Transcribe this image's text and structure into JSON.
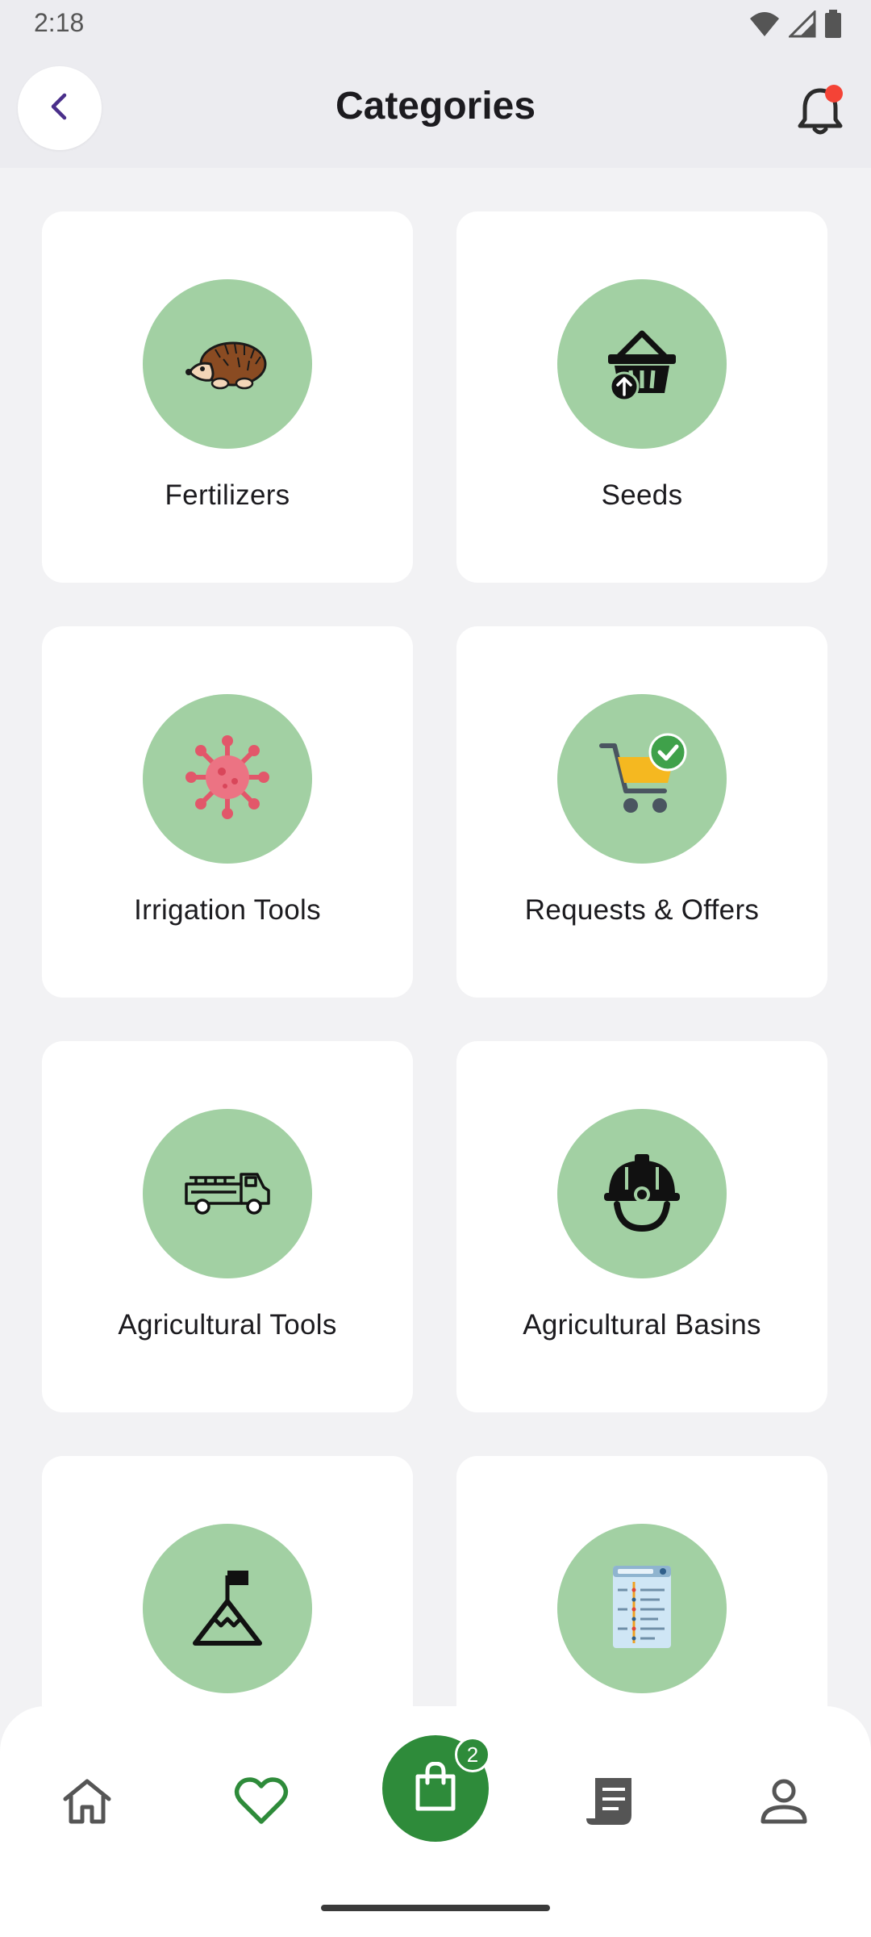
{
  "status_bar": {
    "time": "2:18",
    "icons": [
      "wifi-icon",
      "cellular-signal-icon",
      "battery-icon"
    ]
  },
  "header": {
    "title": "Categories",
    "back_icon": "chevron-left-icon",
    "notification_icon": "bell-icon",
    "notification_dot_color": "#f44336"
  },
  "categories": [
    {
      "label": "Fertilizers",
      "icon": "hedgehog-icon"
    },
    {
      "label": "Seeds",
      "icon": "basket-upload-icon"
    },
    {
      "label": "Irrigation Tools",
      "icon": "virus-icon"
    },
    {
      "label": "Requests & Offers",
      "icon": "cart-check-icon"
    },
    {
      "label": "Agricultural Tools",
      "icon": "fire-truck-icon"
    },
    {
      "label": "Agricultural Basins",
      "icon": "miner-helmet-icon"
    },
    {
      "label": "",
      "icon": "mountain-flag-icon"
    },
    {
      "label": "",
      "icon": "document-list-icon"
    }
  ],
  "bottom_nav": {
    "items": [
      "home-icon",
      "heart-icon",
      "cart-icon",
      "receipt-icon",
      "profile-icon"
    ],
    "cart_badge": "2",
    "active_color": "#2e8b3a"
  },
  "colors": {
    "background": "#f2f2f4",
    "app_bar": "#ececf0",
    "icon_circle": "#a2d0a3",
    "accent": "#2e8b3a",
    "back_chevron": "#4a2f8a"
  }
}
